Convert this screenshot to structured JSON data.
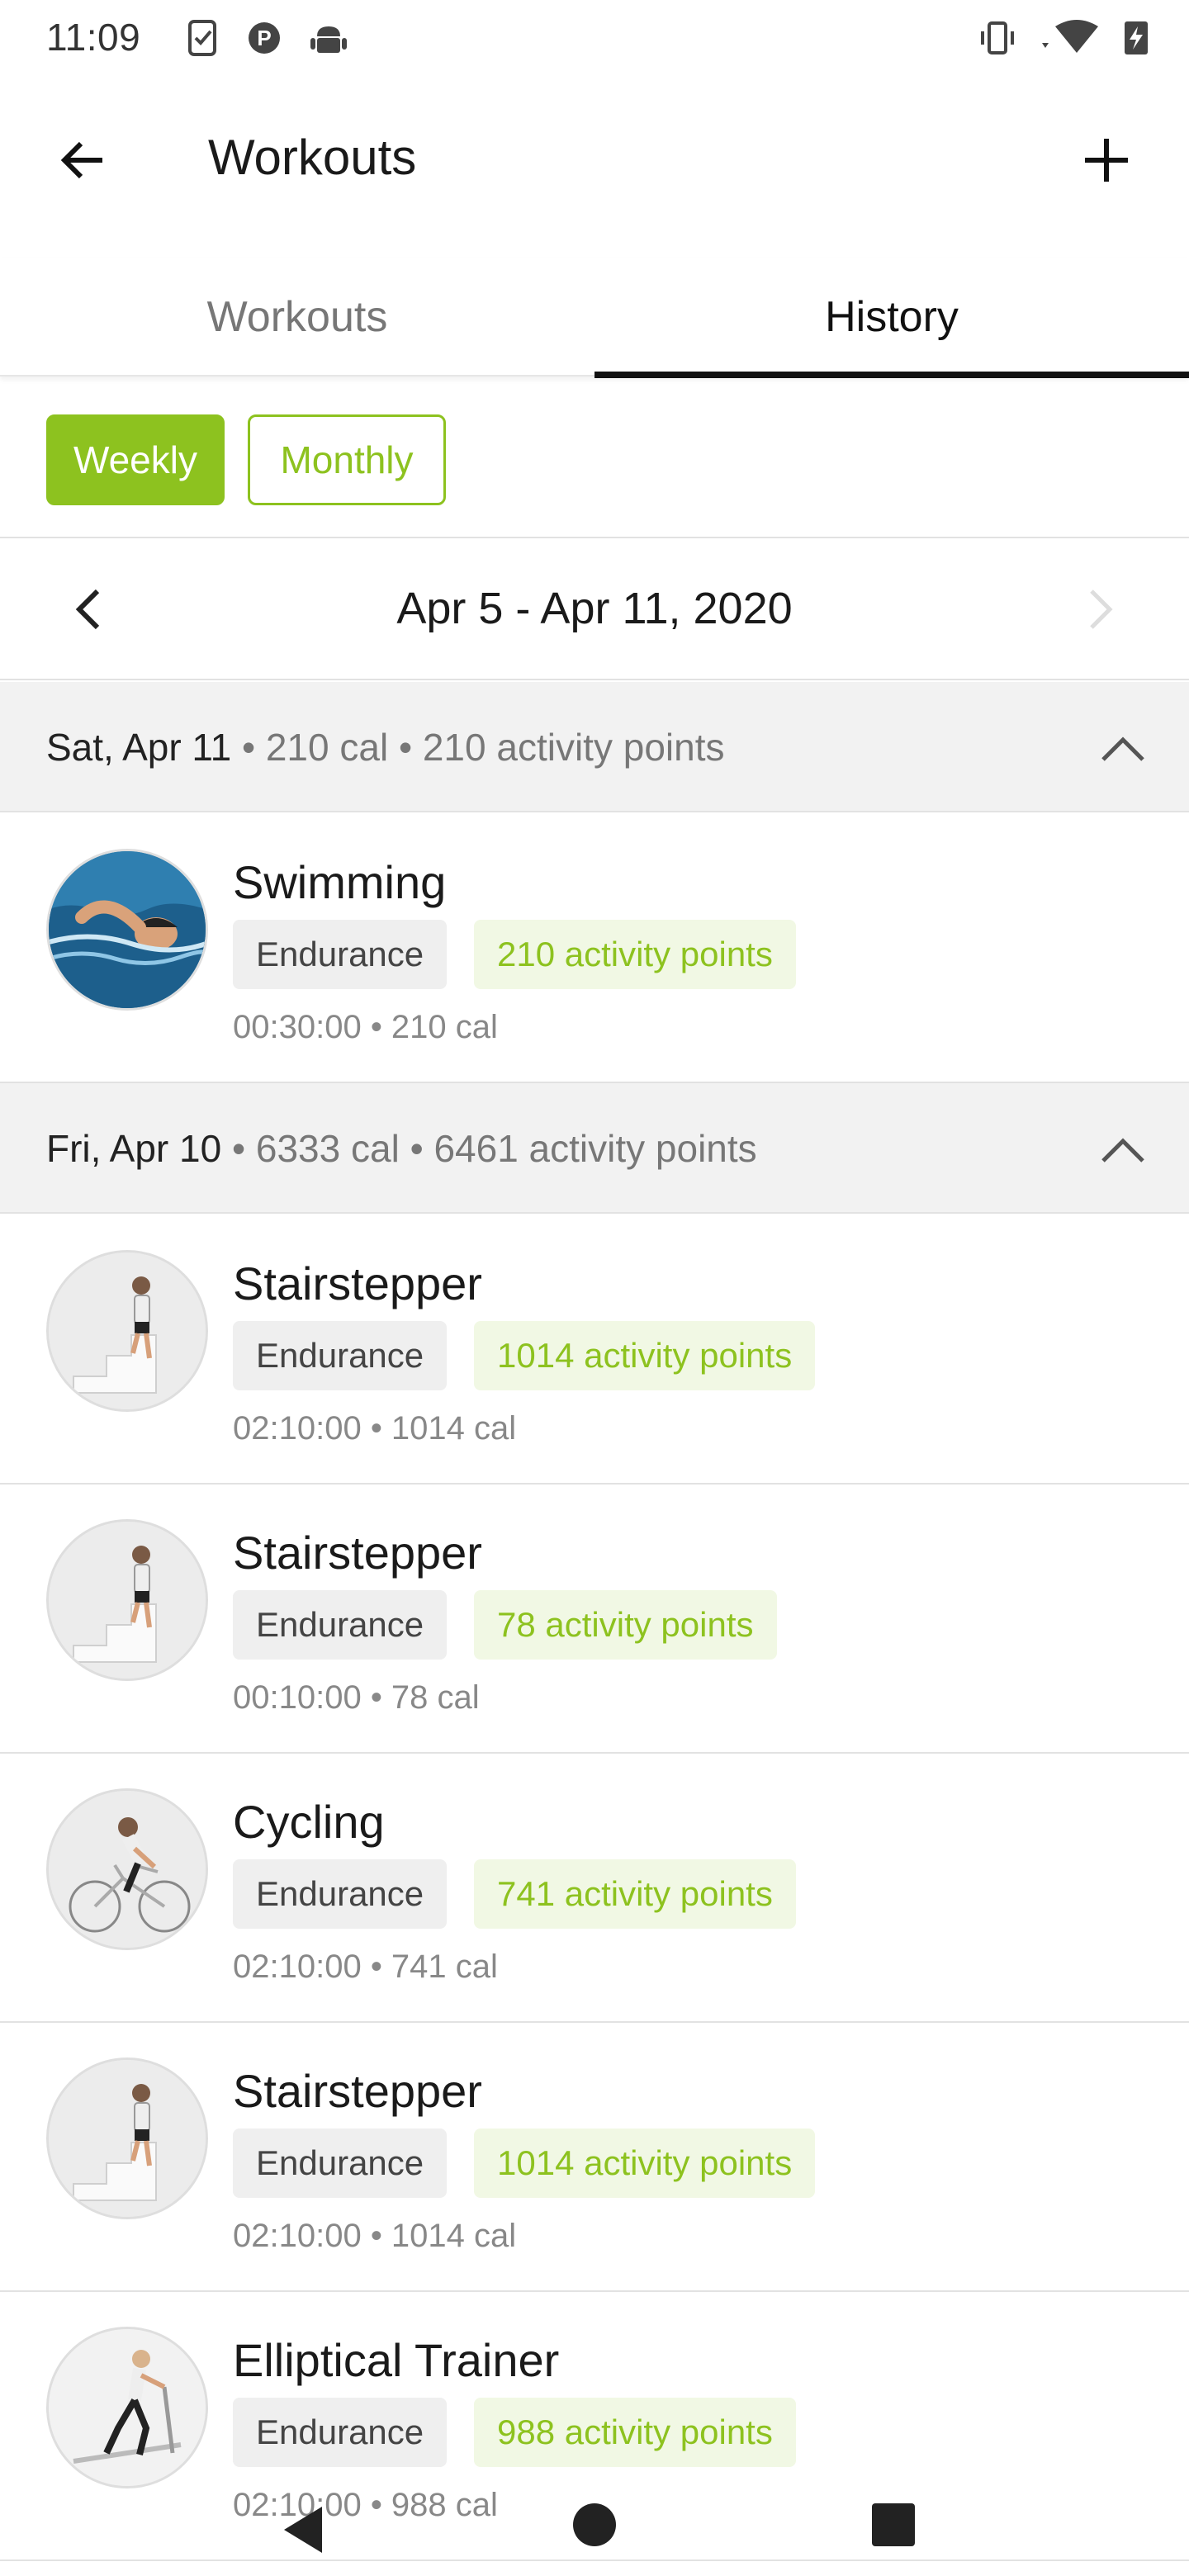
{
  "status_bar": {
    "time": "11:09",
    "left_icons": [
      "task-check-icon",
      "parking-p-icon",
      "android-icon"
    ],
    "right_icons": [
      "vibrate-icon",
      "wifi-icon",
      "battery-charging-icon"
    ]
  },
  "app_bar": {
    "title": "Workouts",
    "back_icon": "arrow-left-icon",
    "add_icon": "plus-icon"
  },
  "tabs": [
    {
      "label": "Workouts",
      "selected": false
    },
    {
      "label": "History",
      "selected": true
    }
  ],
  "period_filter": {
    "options": [
      {
        "label": "Weekly",
        "selected": true
      },
      {
        "label": "Monthly",
        "selected": false
      }
    ]
  },
  "week_nav": {
    "label": "Apr 5 - Apr 11, 2020",
    "prev_enabled": true,
    "next_enabled": false
  },
  "days": [
    {
      "date": "Sat, Apr 11",
      "meta": " • 210 cal • 210 activity points",
      "expanded": true,
      "workouts": [
        {
          "name": "Swimming",
          "category": "Endurance",
          "points": "210 activity points",
          "meta": "00:30:00 • 210 cal",
          "avatar": "swimming"
        }
      ]
    },
    {
      "date": "Fri, Apr 10",
      "meta": " • 6333 cal • 6461 activity points",
      "expanded": true,
      "workouts": [
        {
          "name": "Stairstepper",
          "category": "Endurance",
          "points": "1014 activity points",
          "meta": "02:10:00 • 1014 cal",
          "avatar": "stairstepper"
        },
        {
          "name": "Stairstepper",
          "category": "Endurance",
          "points": "78 activity points",
          "meta": "00:10:00 • 78 cal",
          "avatar": "stairstepper"
        },
        {
          "name": "Cycling",
          "category": "Endurance",
          "points": "741 activity points",
          "meta": "02:10:00 • 741 cal",
          "avatar": "cycling"
        },
        {
          "name": "Stairstepper",
          "category": "Endurance",
          "points": "1014 activity points",
          "meta": "02:10:00 • 1014 cal",
          "avatar": "stairstepper"
        },
        {
          "name": "Elliptical Trainer",
          "category": "Endurance",
          "points": "988 activity points",
          "meta": "02:10:00 • 988 cal",
          "avatar": "elliptical"
        }
      ]
    }
  ],
  "colors": {
    "accent": "#8dc21f",
    "accent_light": "#f1f8e4",
    "header_bg": "#f2f2f2",
    "text_primary": "#1a1a1a",
    "text_secondary": "#888888"
  }
}
